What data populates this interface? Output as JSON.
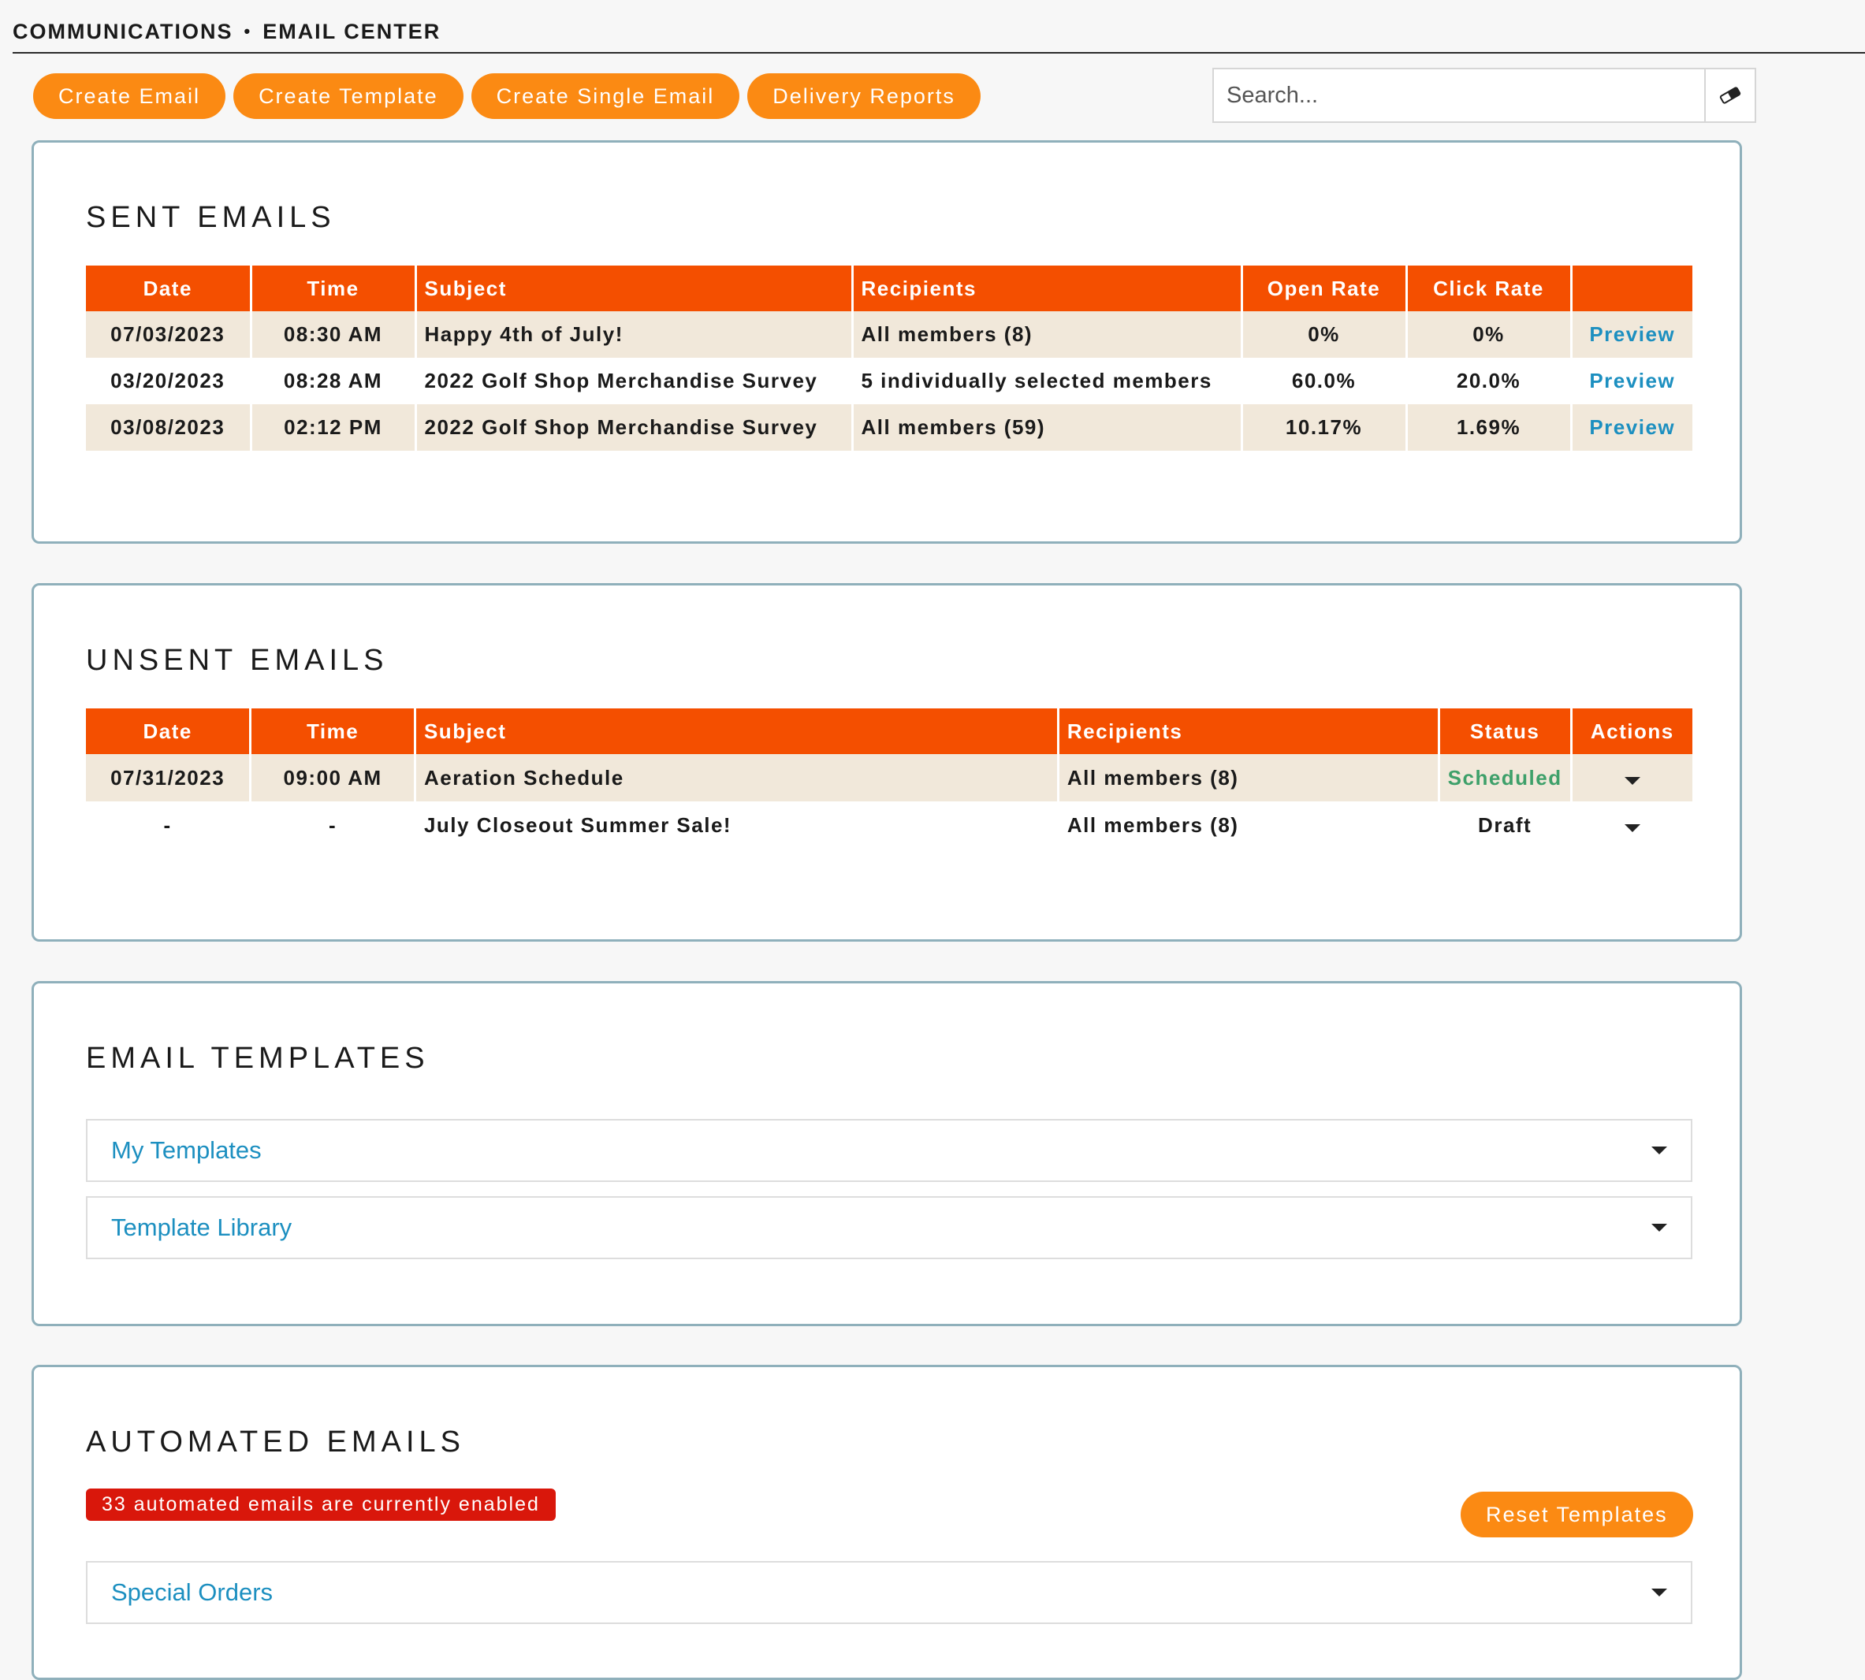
{
  "breadcrumb": {
    "section": "COMMUNICATIONS",
    "separator": "•",
    "page": "EMAIL CENTER"
  },
  "toolbar": {
    "buttons": [
      "Create Email",
      "Create Template",
      "Create Single Email",
      "Delivery Reports"
    ],
    "search_placeholder": "Search..."
  },
  "sent": {
    "title": "SENT EMAILS",
    "headers": [
      "Date",
      "Time",
      "Subject",
      "Recipients",
      "Open Rate",
      "Click Rate",
      ""
    ],
    "rows": [
      {
        "date": "07/03/2023",
        "time": "08:30 AM",
        "subject": "Happy 4th of July!",
        "recipients": "All members (8)",
        "open_rate": "0%",
        "click_rate": "0%",
        "action": "Preview"
      },
      {
        "date": "03/20/2023",
        "time": "08:28 AM",
        "subject": "2022 Golf Shop Merchandise Survey",
        "recipients": "5 individually selected members",
        "open_rate": "60.0%",
        "click_rate": "20.0%",
        "action": "Preview"
      },
      {
        "date": "03/08/2023",
        "time": "02:12 PM",
        "subject": "2022 Golf Shop Merchandise Survey",
        "recipients": "All members (59)",
        "open_rate": "10.17%",
        "click_rate": "1.69%",
        "action": "Preview"
      }
    ]
  },
  "unsent": {
    "title": "UNSENT EMAILS",
    "headers": [
      "Date",
      "Time",
      "Subject",
      "Recipients",
      "Status",
      "Actions"
    ],
    "rows": [
      {
        "date": "07/31/2023",
        "time": "09:00 AM",
        "subject": "Aeration Schedule",
        "recipients": "All members (8)",
        "status": "Scheduled"
      },
      {
        "date": "-",
        "time": "-",
        "subject": "July Closeout Summer Sale!",
        "recipients": "All members (8)",
        "status": "Draft"
      }
    ]
  },
  "templates": {
    "title": "EMAIL TEMPLATES",
    "items": [
      "My Templates",
      "Template Library"
    ]
  },
  "automated": {
    "title": "AUTOMATED EMAILS",
    "badge": "33 automated emails are currently enabled",
    "reset_label": "Reset Templates",
    "items": [
      "Special Orders"
    ]
  },
  "colors": {
    "accent": "#fb8a13",
    "table_header": "#f44f00",
    "link": "#1c8fc0",
    "scheduled": "#3ea06a",
    "badge": "#d9170b",
    "panel_border": "#8fb0bb"
  },
  "icons": {
    "search_clear": "eraser-icon",
    "expand": "caret-down-icon"
  }
}
